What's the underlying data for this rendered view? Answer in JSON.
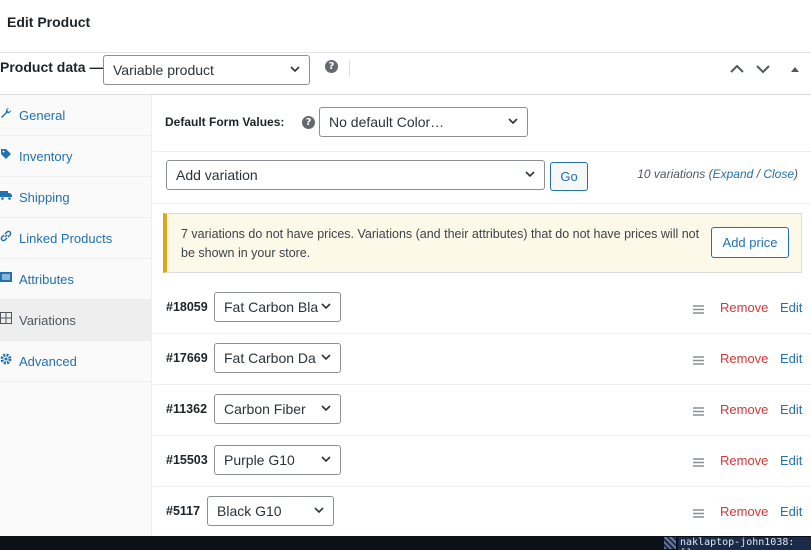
{
  "page": {
    "title": "Edit Product"
  },
  "product_data": {
    "label": "Product data —",
    "type_value": "Variable product",
    "help_glyph": "?"
  },
  "tabs": [
    {
      "label": "General",
      "icon": "wrench-icon"
    },
    {
      "label": "Inventory",
      "icon": "tag-icon"
    },
    {
      "label": "Shipping",
      "icon": "truck-icon"
    },
    {
      "label": "Linked Products",
      "icon": "link-icon"
    },
    {
      "label": "Attributes",
      "icon": "list-icon"
    },
    {
      "label": "Variations",
      "icon": "grid-icon"
    },
    {
      "label": "Advanced",
      "icon": "gear-icon"
    }
  ],
  "active_tab": "Variations",
  "default_form": {
    "label": "Default Form Values:",
    "value": "No default Color…"
  },
  "add_variation": {
    "value": "Add variation",
    "go_label": "Go"
  },
  "variation_count": {
    "text": "10 variations (",
    "expand": "Expand",
    "sep": " / ",
    "close": "Close",
    "end": ")"
  },
  "notice": {
    "message": "7 variations do not have prices. Variations (and their attributes) that do not have prices will not be shown in your store.",
    "button_label": "Add price"
  },
  "variations": [
    {
      "id": "#18059",
      "value": "Fat Carbon Bla",
      "remove": "Remove",
      "edit": "Edit"
    },
    {
      "id": "#17669",
      "value": "Fat Carbon Da",
      "remove": "Remove",
      "edit": "Edit"
    },
    {
      "id": "#11362",
      "value": "Carbon Fiber",
      "remove": "Remove",
      "edit": "Edit"
    },
    {
      "id": "#15503",
      "value": "Purple G10",
      "remove": "Remove",
      "edit": "Edit"
    },
    {
      "id": "#5117",
      "value": "Black G10",
      "remove": "Remove",
      "edit": "Edit"
    }
  ],
  "terminal": {
    "host": "naklaptop-john1038: []"
  },
  "colors": {
    "link": "#2271b1",
    "danger": "#d63638",
    "notice_border": "#dba617",
    "notice_bg": "#fcf9e8"
  }
}
